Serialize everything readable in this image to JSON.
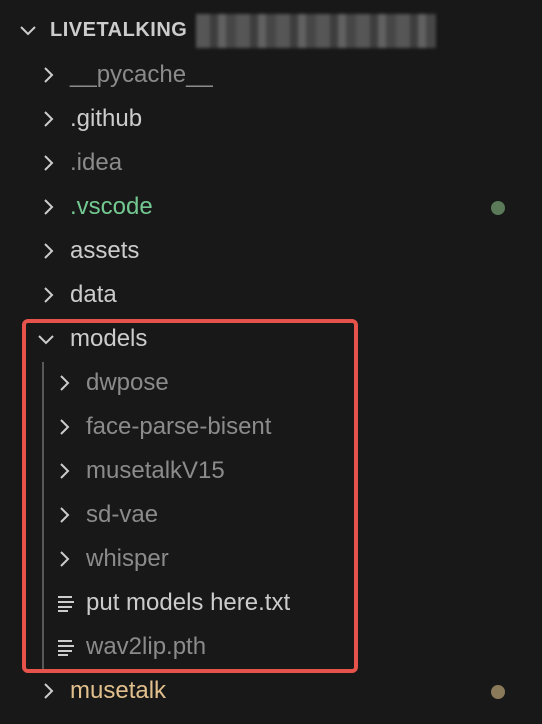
{
  "explorer": {
    "section_title": "LIVETALKING",
    "section_chevron_icon": "chevron-down-icon",
    "items": [
      {
        "label": "__pycache__",
        "type": "folder",
        "expanded": false,
        "color": "#8b8b8b"
      },
      {
        "label": ".github",
        "type": "folder",
        "expanded": false,
        "color": "#cccccc"
      },
      {
        "label": ".idea",
        "type": "folder",
        "expanded": false,
        "color": "#8b8b8b"
      },
      {
        "label": ".vscode",
        "type": "folder",
        "expanded": false,
        "color": "#73c991",
        "status_dot_color": "#5a7a5a"
      },
      {
        "label": "assets",
        "type": "folder",
        "expanded": false,
        "color": "#cccccc"
      },
      {
        "label": "data",
        "type": "folder",
        "expanded": false,
        "color": "#cccccc"
      },
      {
        "label": "models",
        "type": "folder",
        "expanded": true,
        "color": "#cccccc"
      },
      {
        "label": "dwpose",
        "type": "folder",
        "expanded": false,
        "color": "#8b8b8b",
        "depth": 1
      },
      {
        "label": "face-parse-bisent",
        "type": "folder",
        "expanded": false,
        "color": "#8b8b8b",
        "depth": 1
      },
      {
        "label": "musetalkV15",
        "type": "folder",
        "expanded": false,
        "color": "#8b8b8b",
        "depth": 1
      },
      {
        "label": "sd-vae",
        "type": "folder",
        "expanded": false,
        "color": "#8b8b8b",
        "depth": 1
      },
      {
        "label": "whisper",
        "type": "folder",
        "expanded": false,
        "color": "#8b8b8b",
        "depth": 1
      },
      {
        "label": "put models here.txt",
        "type": "file",
        "color": "#cccccc",
        "depth": 1
      },
      {
        "label": "wav2lip.pth",
        "type": "file",
        "color": "#8b8b8b",
        "depth": 1
      },
      {
        "label": "musetalk",
        "type": "folder",
        "expanded": false,
        "color": "#e2c08d",
        "status_dot_color": "#8a7a5a"
      }
    ]
  },
  "colors": {
    "background": "#181818",
    "highlight_border": "#e5534b",
    "indent_guide": "#585858"
  }
}
